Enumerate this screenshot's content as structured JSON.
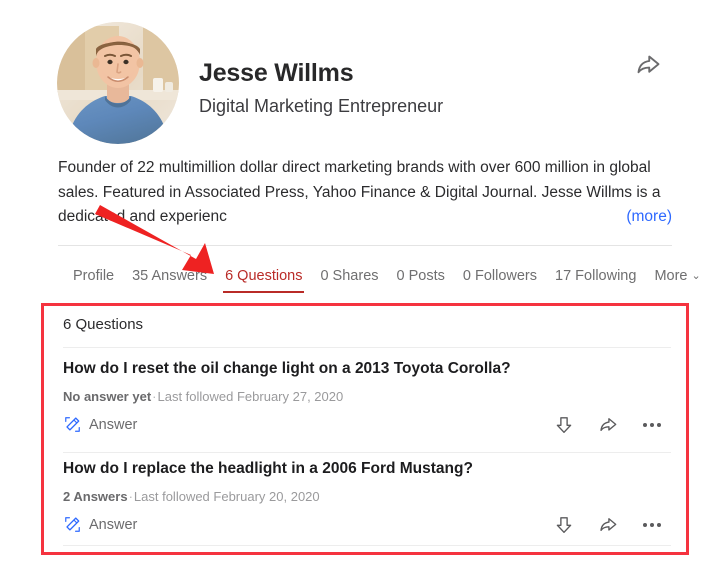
{
  "profile": {
    "name": "Jesse Willms",
    "tagline": "Digital Marketing Entrepreneur",
    "avatar_alt": "profile-photo",
    "bio": "Founder of 22 multimillion dollar direct marketing brands with over 600 million in global sales. Featured in Associated Press, Yahoo Finance & Digital Journal. Jesse Willms is a dedicated and experienc",
    "more_label": "(more)",
    "share_icon": "share-arrow-icon"
  },
  "tabs": [
    {
      "label": "Profile",
      "active": false
    },
    {
      "label": "35 Answers",
      "active": false
    },
    {
      "label": "6 Questions",
      "active": true
    },
    {
      "label": "0 Shares",
      "active": false
    },
    {
      "label": "0 Posts",
      "active": false
    },
    {
      "label": "0 Followers",
      "active": false
    },
    {
      "label": "17 Following",
      "active": false
    },
    {
      "label": "More",
      "active": false,
      "chevron": "⌄"
    }
  ],
  "questions_panel": {
    "title": "6 Questions",
    "items": [
      {
        "title": "How do I reset the oil change light on a 2013 Toyota Corolla?",
        "answer_count": "No answer yet",
        "separator": "·",
        "followed": "Last followed February 27, 2020",
        "answer_label": "Answer",
        "answer_icon": "pencil-edit-icon",
        "downvote_icon": "downvote-arrow-icon",
        "share_icon": "share-arrow-icon",
        "more_icon": "three-dots-icon"
      },
      {
        "title": "How do I replace the headlight in a 2006 Ford Mustang?",
        "answer_count": "2 Answers",
        "separator": "·",
        "followed": "Last followed February 20, 2020",
        "answer_label": "Answer",
        "answer_icon": "pencil-edit-icon",
        "downvote_icon": "downvote-arrow-icon",
        "share_icon": "share-arrow-icon",
        "more_icon": "three-dots-icon"
      }
    ]
  },
  "annotations": {
    "highlight_box_color": "#f5333f",
    "arrow_color": "#ee2222",
    "arrow_points_to": "6 Questions"
  },
  "colors": {
    "accent_red": "#b92b27",
    "link_blue": "#2e69ff",
    "text_primary": "#282829",
    "text_muted": "#9a9a9c"
  }
}
